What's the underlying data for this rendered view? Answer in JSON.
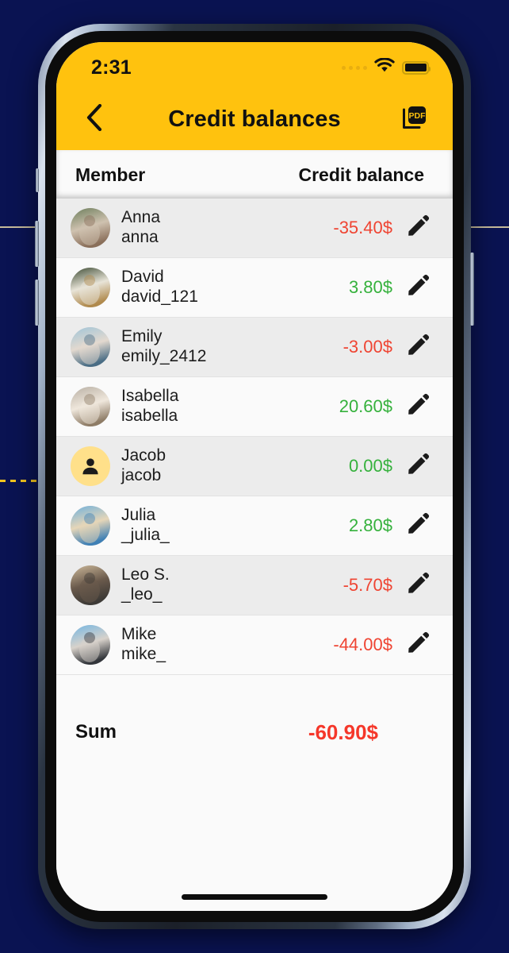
{
  "statusbar": {
    "time": "2:31",
    "signal_icon": "signal-dots-icon",
    "wifi_icon": "wifi-icon",
    "battery_icon": "battery-full-icon"
  },
  "navbar": {
    "back_icon": "chevron-left-icon",
    "title": "Credit balances",
    "pdf_icon": "pdf-export-icon",
    "pdf_label": "PDF",
    "accent_color": "#FFC20E"
  },
  "table": {
    "columns": {
      "member": "Member",
      "balance": "Credit balance"
    },
    "edit_icon": "pencil-icon",
    "rows": [
      {
        "name": "Anna",
        "username": "anna",
        "amount": "-35.40$",
        "sign": "neg",
        "avatar": "photo"
      },
      {
        "name": "David",
        "username": "david_121",
        "amount": "3.80$",
        "sign": "pos",
        "avatar": "photo"
      },
      {
        "name": "Emily",
        "username": "emily_2412",
        "amount": "-3.00$",
        "sign": "neg",
        "avatar": "photo"
      },
      {
        "name": "Isabella",
        "username": "isabella",
        "amount": "20.60$",
        "sign": "pos",
        "avatar": "photo"
      },
      {
        "name": "Jacob",
        "username": "jacob",
        "amount": "0.00$",
        "sign": "pos",
        "avatar": "placeholder"
      },
      {
        "name": "Julia",
        "username": "_julia_",
        "amount": "2.80$",
        "sign": "pos",
        "avatar": "photo"
      },
      {
        "name": "Leo S.",
        "username": "_leo_",
        "amount": "-5.70$",
        "sign": "neg",
        "avatar": "photo"
      },
      {
        "name": "Mike",
        "username": "mike_",
        "amount": "-44.00$",
        "sign": "neg",
        "avatar": "photo"
      }
    ],
    "sum": {
      "label": "Sum",
      "value": "-60.90$",
      "color": "#f5372a"
    }
  },
  "colors": {
    "negative": "#ef4432",
    "positive": "#35b13c",
    "row_odd": "#ececec",
    "row_even": "#fafafa",
    "background": "#0a1352"
  }
}
